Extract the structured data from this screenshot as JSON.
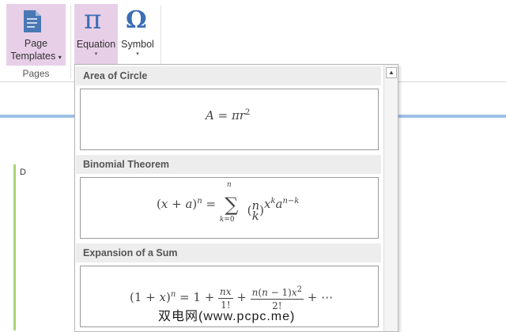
{
  "ribbon": {
    "page_templates_line1": "Page",
    "page_templates_line2": "Templates",
    "pages_group": "Pages",
    "equation": "Equation",
    "symbol": "Symbol",
    "pi_glyph": "π",
    "omega_glyph": "Ω",
    "dropdown_arrow": "▾"
  },
  "document": {
    "text": "D"
  },
  "gallery": {
    "items": [
      {
        "title": "Area of Circle"
      },
      {
        "title": "Binomial Theorem"
      },
      {
        "title": "Expansion of a Sum"
      }
    ],
    "scroll_up": "▲"
  },
  "watermark": "双电网(www.pcpc.me)",
  "colors": {
    "selected": "#e8cfe8",
    "accent": "#3d6eb4",
    "line": "#9ec0e4",
    "green": "#a6d575"
  }
}
